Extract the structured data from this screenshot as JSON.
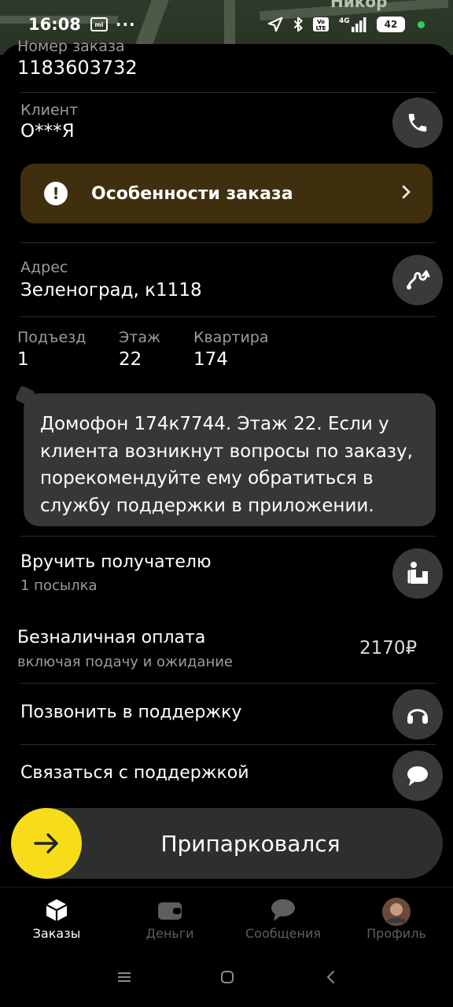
{
  "status_bar": {
    "time": "16:08",
    "dots": "···",
    "battery": "42",
    "signal_label": "4G"
  },
  "map": {
    "label": "Никор"
  },
  "order": {
    "number_label": "Номер заказа",
    "number": "1183603732",
    "client_label": "Клиент",
    "client": "О***Я",
    "features_label": "Особенности заказа",
    "address_label": "Адрес",
    "address": "Зеленоград, к1118",
    "entrance_label": "Подъезд",
    "entrance": "1",
    "floor_label": "Этаж",
    "floor": "22",
    "apartment_label": "Квартира",
    "apartment": "174",
    "comment_lines": [
      "Домофон 174к7744. Этаж 22. Если у",
      "клиента возникнут вопросы по заказу,",
      "порекомендуйте ему обратиться в",
      "службу поддержки в приложении."
    ],
    "handover_title": "Вручить получателю",
    "handover_sub": "1 посылка"
  },
  "payment": {
    "title": "Безналичная оплата",
    "subtitle": "включая подачу и ожидание",
    "amount": "2170₽",
    "call_support": "Позвонить в поддержку",
    "contact_support": "Связаться с поддержкой"
  },
  "action": {
    "label": "Припарковался"
  },
  "nav": {
    "items": [
      {
        "label": "Заказы",
        "icon": "box-icon"
      },
      {
        "label": "Деньги",
        "icon": "wallet-icon"
      },
      {
        "label": "Сообщения",
        "icon": "chat-icon"
      },
      {
        "label": "Профиль",
        "icon": "avatar"
      }
    ]
  },
  "colors": {
    "accent_yellow": "#f7dc1a",
    "features_bg": "#3f2f0f",
    "bubble_bg": "#373737",
    "round_btn_bg": "#3a3a3a"
  }
}
